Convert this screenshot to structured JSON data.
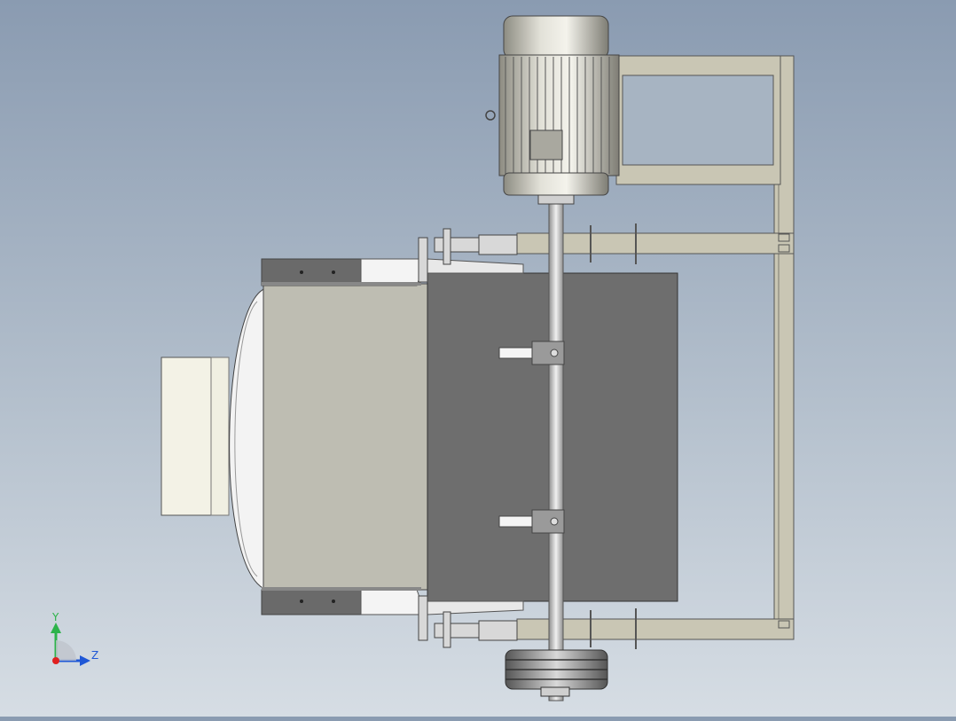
{
  "viewport": {
    "background_top": "#8a9bb1",
    "background_bottom": "#d6dde4"
  },
  "colors": {
    "frame": "#c9c6b4",
    "frame_dark": "#9e9b8b",
    "housing": "#bebdb2",
    "drum": "#6e6e6e",
    "motor": "#c9c8bd",
    "plate": "#6a6a6a",
    "cream": "#f3f2e6"
  },
  "triad": {
    "y_label": "Y",
    "z_label": "Z",
    "y_color": "#2db34a",
    "z_color": "#1f57d6",
    "x_color": "#e02020"
  }
}
